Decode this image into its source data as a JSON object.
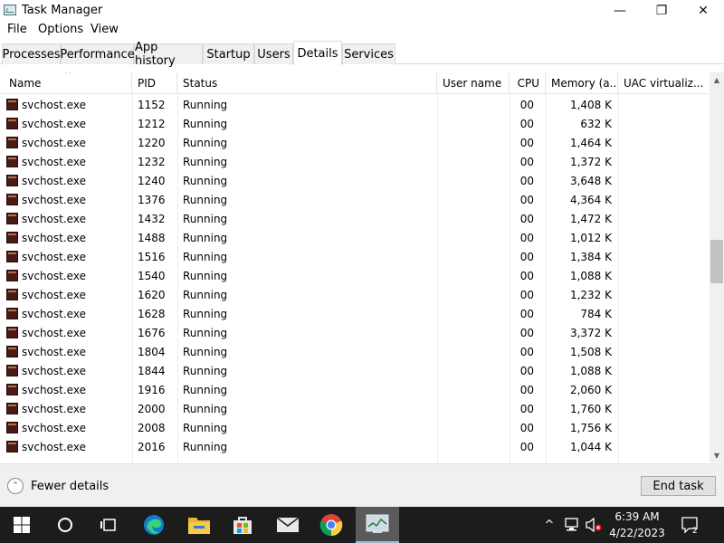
{
  "window": {
    "title": "Task Manager",
    "controls": {
      "minimize": "—",
      "maximize": "❐",
      "close": "✕"
    }
  },
  "menu": [
    "File",
    "Options",
    "View"
  ],
  "tabs": [
    {
      "label": "Processes",
      "active": false
    },
    {
      "label": "Performance",
      "active": false
    },
    {
      "label": "App history",
      "active": false
    },
    {
      "label": "Startup",
      "active": false
    },
    {
      "label": "Users",
      "active": false
    },
    {
      "label": "Details",
      "active": true
    },
    {
      "label": "Services",
      "active": false
    }
  ],
  "table": {
    "columns": [
      "Name",
      "PID",
      "Status",
      "User name",
      "CPU",
      "Memory (a...",
      "UAC virtualiz..."
    ],
    "sorted_by": "Name",
    "rows": [
      {
        "name": "svchost.exe",
        "pid": "1152",
        "status": "Running",
        "user": "",
        "cpu": "00",
        "memory": "1,408 K"
      },
      {
        "name": "svchost.exe",
        "pid": "1212",
        "status": "Running",
        "user": "",
        "cpu": "00",
        "memory": "632 K"
      },
      {
        "name": "svchost.exe",
        "pid": "1220",
        "status": "Running",
        "user": "",
        "cpu": "00",
        "memory": "1,464 K"
      },
      {
        "name": "svchost.exe",
        "pid": "1232",
        "status": "Running",
        "user": "",
        "cpu": "00",
        "memory": "1,372 K"
      },
      {
        "name": "svchost.exe",
        "pid": "1240",
        "status": "Running",
        "user": "",
        "cpu": "00",
        "memory": "3,648 K"
      },
      {
        "name": "svchost.exe",
        "pid": "1376",
        "status": "Running",
        "user": "",
        "cpu": "00",
        "memory": "4,364 K"
      },
      {
        "name": "svchost.exe",
        "pid": "1432",
        "status": "Running",
        "user": "",
        "cpu": "00",
        "memory": "1,472 K"
      },
      {
        "name": "svchost.exe",
        "pid": "1488",
        "status": "Running",
        "user": "",
        "cpu": "00",
        "memory": "1,012 K"
      },
      {
        "name": "svchost.exe",
        "pid": "1516",
        "status": "Running",
        "user": "",
        "cpu": "00",
        "memory": "1,384 K"
      },
      {
        "name": "svchost.exe",
        "pid": "1540",
        "status": "Running",
        "user": "",
        "cpu": "00",
        "memory": "1,088 K"
      },
      {
        "name": "svchost.exe",
        "pid": "1620",
        "status": "Running",
        "user": "",
        "cpu": "00",
        "memory": "1,232 K"
      },
      {
        "name": "svchost.exe",
        "pid": "1628",
        "status": "Running",
        "user": "",
        "cpu": "00",
        "memory": "784 K"
      },
      {
        "name": "svchost.exe",
        "pid": "1676",
        "status": "Running",
        "user": "",
        "cpu": "00",
        "memory": "3,372 K"
      },
      {
        "name": "svchost.exe",
        "pid": "1804",
        "status": "Running",
        "user": "",
        "cpu": "00",
        "memory": "1,508 K"
      },
      {
        "name": "svchost.exe",
        "pid": "1844",
        "status": "Running",
        "user": "",
        "cpu": "00",
        "memory": "1,088 K"
      },
      {
        "name": "svchost.exe",
        "pid": "1916",
        "status": "Running",
        "user": "",
        "cpu": "00",
        "memory": "2,060 K"
      },
      {
        "name": "svchost.exe",
        "pid": "2000",
        "status": "Running",
        "user": "",
        "cpu": "00",
        "memory": "1,760 K"
      },
      {
        "name": "svchost.exe",
        "pid": "2008",
        "status": "Running",
        "user": "",
        "cpu": "00",
        "memory": "1,756 K"
      },
      {
        "name": "svchost.exe",
        "pid": "2016",
        "status": "Running",
        "user": "",
        "cpu": "00",
        "memory": "1,044 K"
      }
    ]
  },
  "footer": {
    "fewer_details": "Fewer details",
    "end_task": "End task"
  },
  "taskbar": {
    "icons": [
      "windows-start-icon",
      "search-circle-icon",
      "task-view-icon",
      "edge-browser-icon",
      "file-explorer-icon",
      "microsoft-store-icon",
      "mail-icon",
      "chrome-icon",
      "task-manager-icon"
    ],
    "tray_icons": [
      "chevron-up-icon",
      "network-icon",
      "volume-muted-icon"
    ],
    "time": "6:39 AM",
    "date": "4/22/2023",
    "notification_count": "2"
  },
  "colors": {
    "taskbar": "#1c1c1c",
    "active_tab": "#ffffff",
    "inactive_tab": "#f0f0f0",
    "process_icon": "#4a1a14"
  }
}
